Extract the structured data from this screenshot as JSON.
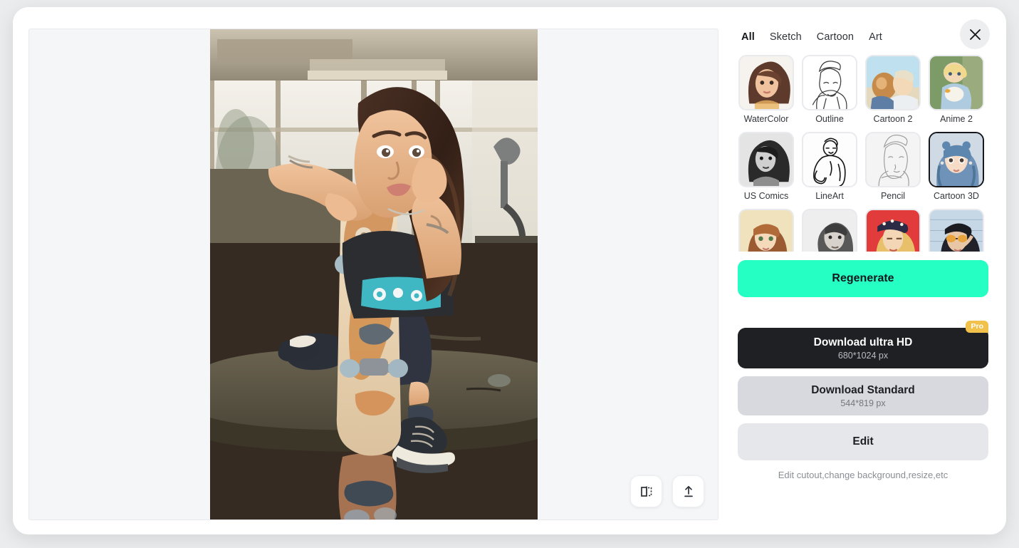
{
  "modal": {
    "close_label": "×",
    "close_icon": "close-icon"
  },
  "canvas": {
    "background_color": "#F5F6F8",
    "image_alt": "Generated portrait of a young woman sitting on a bench holding a skateboard",
    "tools": [
      {
        "name": "compare-icon",
        "label": "Compare"
      },
      {
        "name": "upload-icon",
        "label": "Upload"
      }
    ]
  },
  "sidebar": {
    "tabs": [
      {
        "label": "All",
        "active": true
      },
      {
        "label": "Sketch",
        "active": false
      },
      {
        "label": "Cartoon",
        "active": false
      },
      {
        "label": "Art",
        "active": false
      }
    ],
    "styles": [
      {
        "label": "WaterColor",
        "selected": false
      },
      {
        "label": "Outline",
        "selected": false
      },
      {
        "label": "Cartoon 2",
        "selected": false
      },
      {
        "label": "Anime 2",
        "selected": false
      },
      {
        "label": "US Comics",
        "selected": false
      },
      {
        "label": "LineArt",
        "selected": false
      },
      {
        "label": "Pencil",
        "selected": false
      },
      {
        "label": "Cartoon 3D",
        "selected": true
      },
      {
        "label": "",
        "selected": false
      },
      {
        "label": "",
        "selected": false
      },
      {
        "label": "",
        "selected": false
      },
      {
        "label": "",
        "selected": false
      }
    ],
    "regenerate": {
      "label": "Regenerate",
      "color": "#25FFC4"
    },
    "download_pro": {
      "title": "Download ultra HD",
      "subtitle": "680*1024 px",
      "badge": "Pro",
      "badge_color": "#F2C14B",
      "color": "#1F2024"
    },
    "download_standard": {
      "title": "Download Standard",
      "subtitle": "544*819 px",
      "color": "#D7D9DE"
    },
    "edit": {
      "label": "Edit",
      "color": "#E6E7EB"
    },
    "edit_hint": "Edit cutout,change background,resize,etc"
  }
}
